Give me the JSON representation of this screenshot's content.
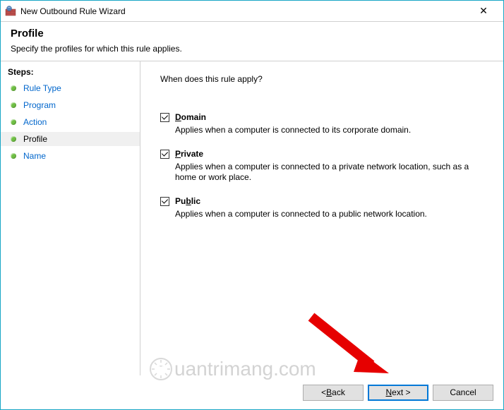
{
  "window": {
    "title": "New Outbound Rule Wizard",
    "close_symbol": "✕"
  },
  "header": {
    "title": "Profile",
    "subtitle": "Specify the profiles for which this rule applies."
  },
  "sidebar": {
    "heading": "Steps:",
    "items": [
      {
        "label": "Rule Type",
        "current": false
      },
      {
        "label": "Program",
        "current": false
      },
      {
        "label": "Action",
        "current": false
      },
      {
        "label": "Profile",
        "current": true
      },
      {
        "label": "Name",
        "current": false
      }
    ]
  },
  "content": {
    "question": "When does this rule apply?",
    "options": [
      {
        "accel": "D",
        "rest": "omain",
        "checked": true,
        "desc": "Applies when a computer is connected to its corporate domain."
      },
      {
        "accel": "P",
        "rest": "rivate",
        "checked": true,
        "desc": "Applies when a computer is connected to a private network location, such as a home or work place."
      },
      {
        "accel": "",
        "rest": "Pu",
        "accel2": "b",
        "rest2": "lic",
        "checked": true,
        "desc": "Applies when a computer is connected to a public network location."
      }
    ]
  },
  "footer": {
    "back_pre": "< ",
    "back_accel": "B",
    "back_rest": "ack",
    "next_accel": "N",
    "next_rest": "ext >",
    "cancel": "Cancel"
  },
  "watermark": "uantrimang.com"
}
